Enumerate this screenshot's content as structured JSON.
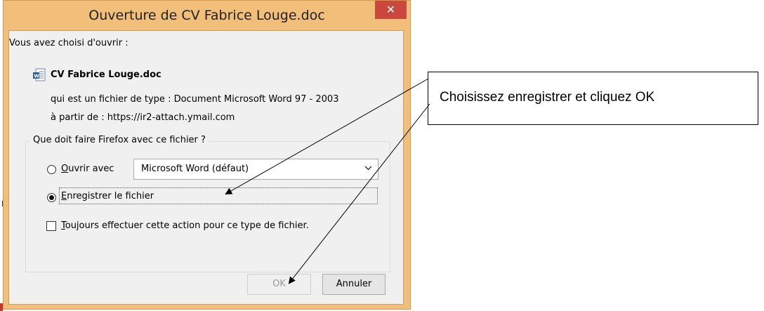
{
  "dialog": {
    "title": "Ouverture de CV Fabrice Louge.doc",
    "close_symbol": "✕",
    "intro": "Vous avez choisi d'ouvrir :",
    "file_name": "CV Fabrice Louge.doc",
    "file_icon": "word-document-icon",
    "type_line": "qui est un fichier de type : Document Microsoft Word 97 - 2003",
    "source_line": "à partir de : https://ir2-attach.ymail.com",
    "group_label": "Que doit faire Firefox avec ce fichier ?",
    "open_with_accel": "O",
    "open_with_rest": "uvrir avec",
    "open_with_app": "Microsoft Word (défaut)",
    "save_accel": "E",
    "save_rest": "nregistrer le fichier",
    "always_accel": "T",
    "always_rest": "oujours effectuer cette action pour ce type de fichier.",
    "ok_label": "OK",
    "cancel_label": "Annuler",
    "selected_option": "save",
    "always_checked": false
  },
  "callout": {
    "text": "Choisissez enregistrer et cliquez OK"
  },
  "colors": {
    "window_frame": "#f2bf7a",
    "close_button": "#c9473c",
    "client_bg": "#f0f0f0"
  }
}
